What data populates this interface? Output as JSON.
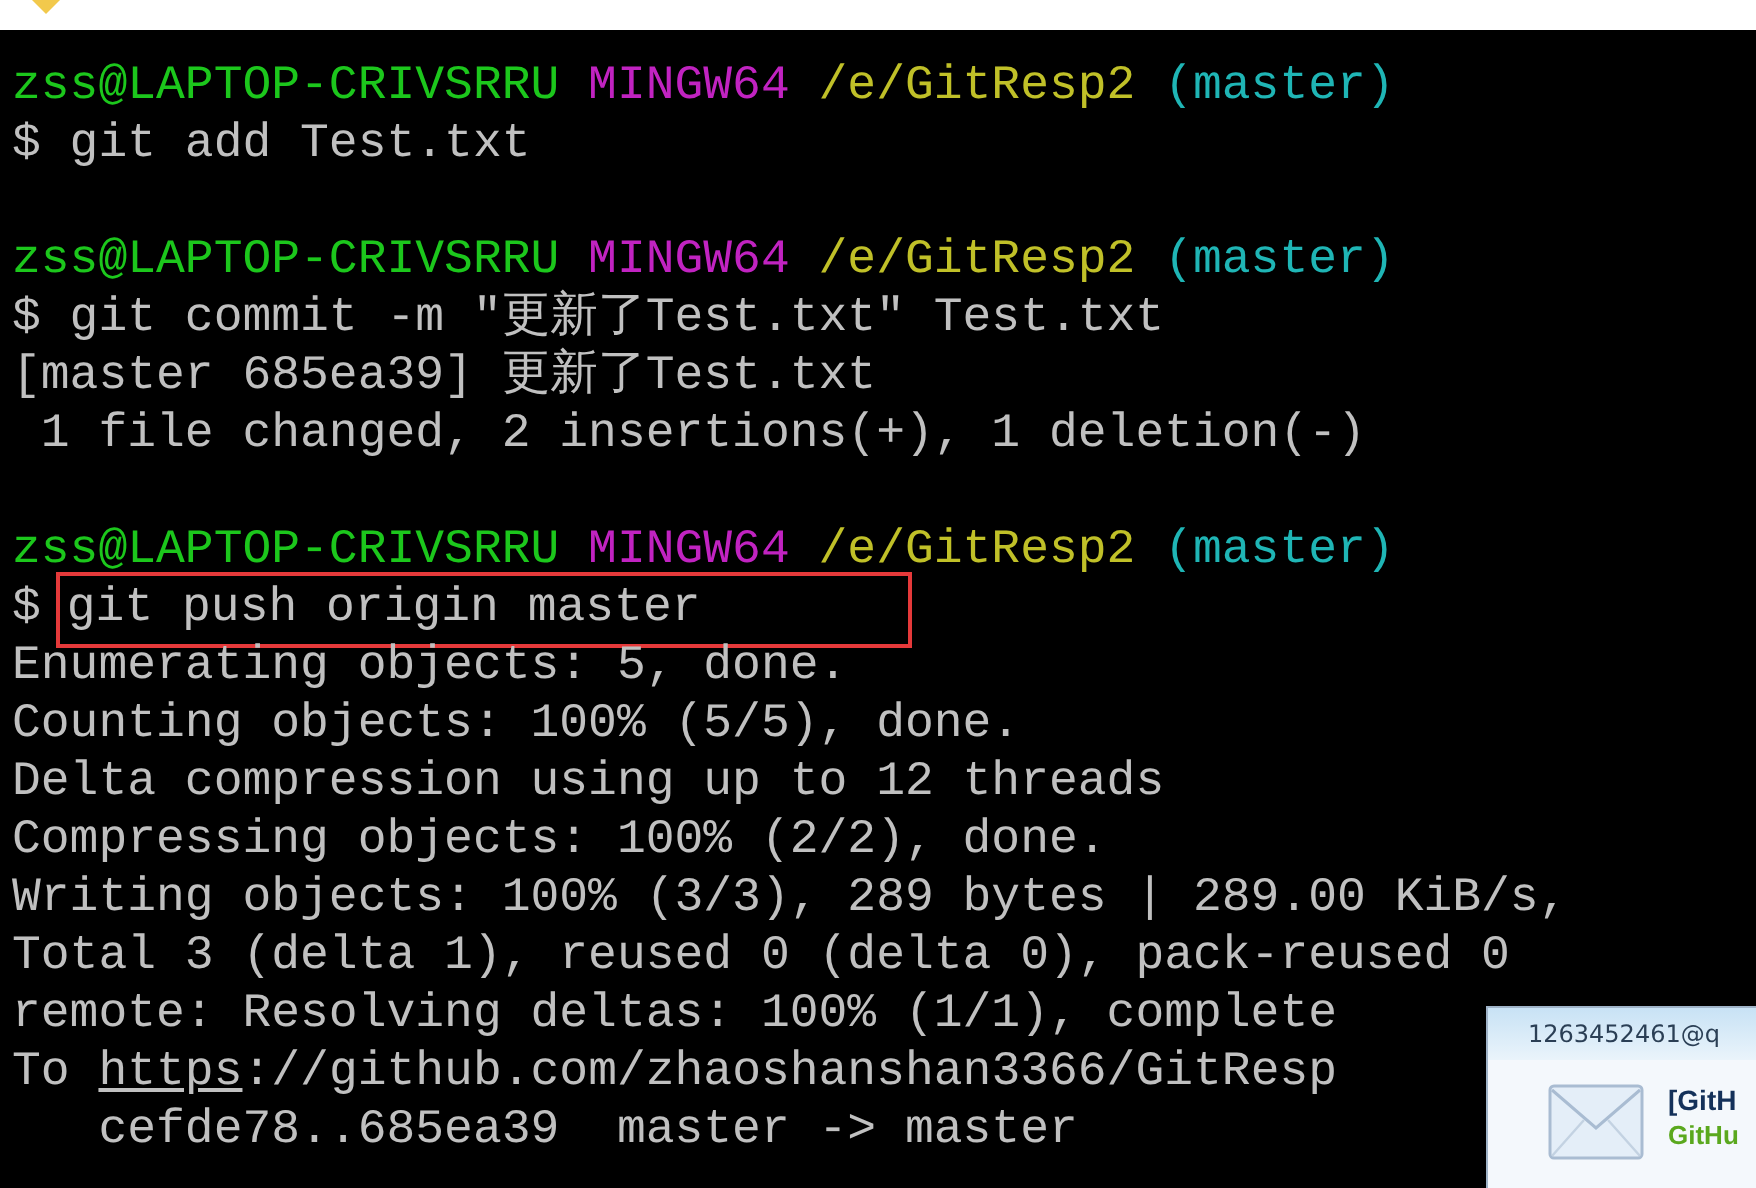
{
  "terminal": {
    "blocks": [
      {
        "lines": [
          {
            "kind": "prompt",
            "segments": [
              {
                "kind": "user",
                "text": "zss@LAPTOP-CRIVSRRU"
              },
              {
                "kind": "system",
                "text": "MINGW64"
              },
              {
                "kind": "path",
                "text": "/e/GitResp2"
              },
              {
                "kind": "branch",
                "text": "(master)"
              }
            ]
          },
          {
            "kind": "output",
            "segments": [
              {
                "kind": "plain",
                "text": "$ git add Test.txt"
              }
            ]
          }
        ]
      },
      {
        "lines": [
          {
            "kind": "prompt",
            "segments": [
              {
                "kind": "user",
                "text": "zss@LAPTOP-CRIVSRRU"
              },
              {
                "kind": "system",
                "text": "MINGW64"
              },
              {
                "kind": "path",
                "text": "/e/GitResp2"
              },
              {
                "kind": "branch",
                "text": "(master)"
              }
            ]
          },
          {
            "kind": "output",
            "segments": [
              {
                "kind": "plain",
                "text": "$ git commit -m \"更新了Test.txt\" Test.txt"
              }
            ]
          },
          {
            "kind": "output",
            "segments": [
              {
                "kind": "plain",
                "text": "[master 685ea39] 更新了Test.txt"
              }
            ]
          },
          {
            "kind": "output",
            "segments": [
              {
                "kind": "plain",
                "text": " 1 file changed, 2 insertions(+), 1 deletion(-)"
              }
            ]
          }
        ]
      },
      {
        "lines": [
          {
            "kind": "prompt",
            "segments": [
              {
                "kind": "user",
                "text": "zss@LAPTOP-CRIVSRRU"
              },
              {
                "kind": "system",
                "text": "MINGW64"
              },
              {
                "kind": "path",
                "text": "/e/GitResp2"
              },
              {
                "kind": "branch",
                "text": "(master)"
              }
            ]
          },
          {
            "kind": "marked",
            "segments": [
              {
                "kind": "plain",
                "text": "$"
              },
              {
                "kind": "plain",
                "text": "git push origin master"
              }
            ]
          },
          {
            "kind": "output",
            "segments": [
              {
                "kind": "plain",
                "text": "Enumerating objects: 5, done."
              }
            ]
          },
          {
            "kind": "output",
            "segments": [
              {
                "kind": "plain",
                "text": "Counting objects: 100% (5/5), done."
              }
            ]
          },
          {
            "kind": "output",
            "segments": [
              {
                "kind": "plain",
                "text": "Delta compression using up to 12 threads"
              }
            ]
          },
          {
            "kind": "output",
            "segments": [
              {
                "kind": "plain",
                "text": "Compressing objects: 100% (2/2), done."
              }
            ]
          },
          {
            "kind": "output",
            "segments": [
              {
                "kind": "plain",
                "text": "Writing objects: 100% (3/3), 289 bytes | 289.00 KiB/s,"
              }
            ]
          },
          {
            "kind": "output",
            "segments": [
              {
                "kind": "plain",
                "text": "Total 3 (delta 1), reused 0 (delta 0), pack-reused 0"
              }
            ]
          },
          {
            "kind": "output",
            "segments": [
              {
                "kind": "plain",
                "text": "remote: Resolving deltas: 100% (1/1), complete"
              }
            ]
          },
          {
            "kind": "output",
            "segments": [
              {
                "kind": "plain",
                "text": "To "
              },
              {
                "kind": "link",
                "text": "https"
              },
              {
                "kind": "plain",
                "text": "://github.com/zhaoshanshan3366/GitResp"
              }
            ]
          },
          {
            "kind": "output",
            "segments": [
              {
                "kind": "plain",
                "text": "   cefde78..685ea39  master -> master"
              }
            ]
          }
        ]
      }
    ]
  },
  "notification": {
    "sender": "1263452461@q",
    "title": "[GitH",
    "source": "GitHu"
  }
}
